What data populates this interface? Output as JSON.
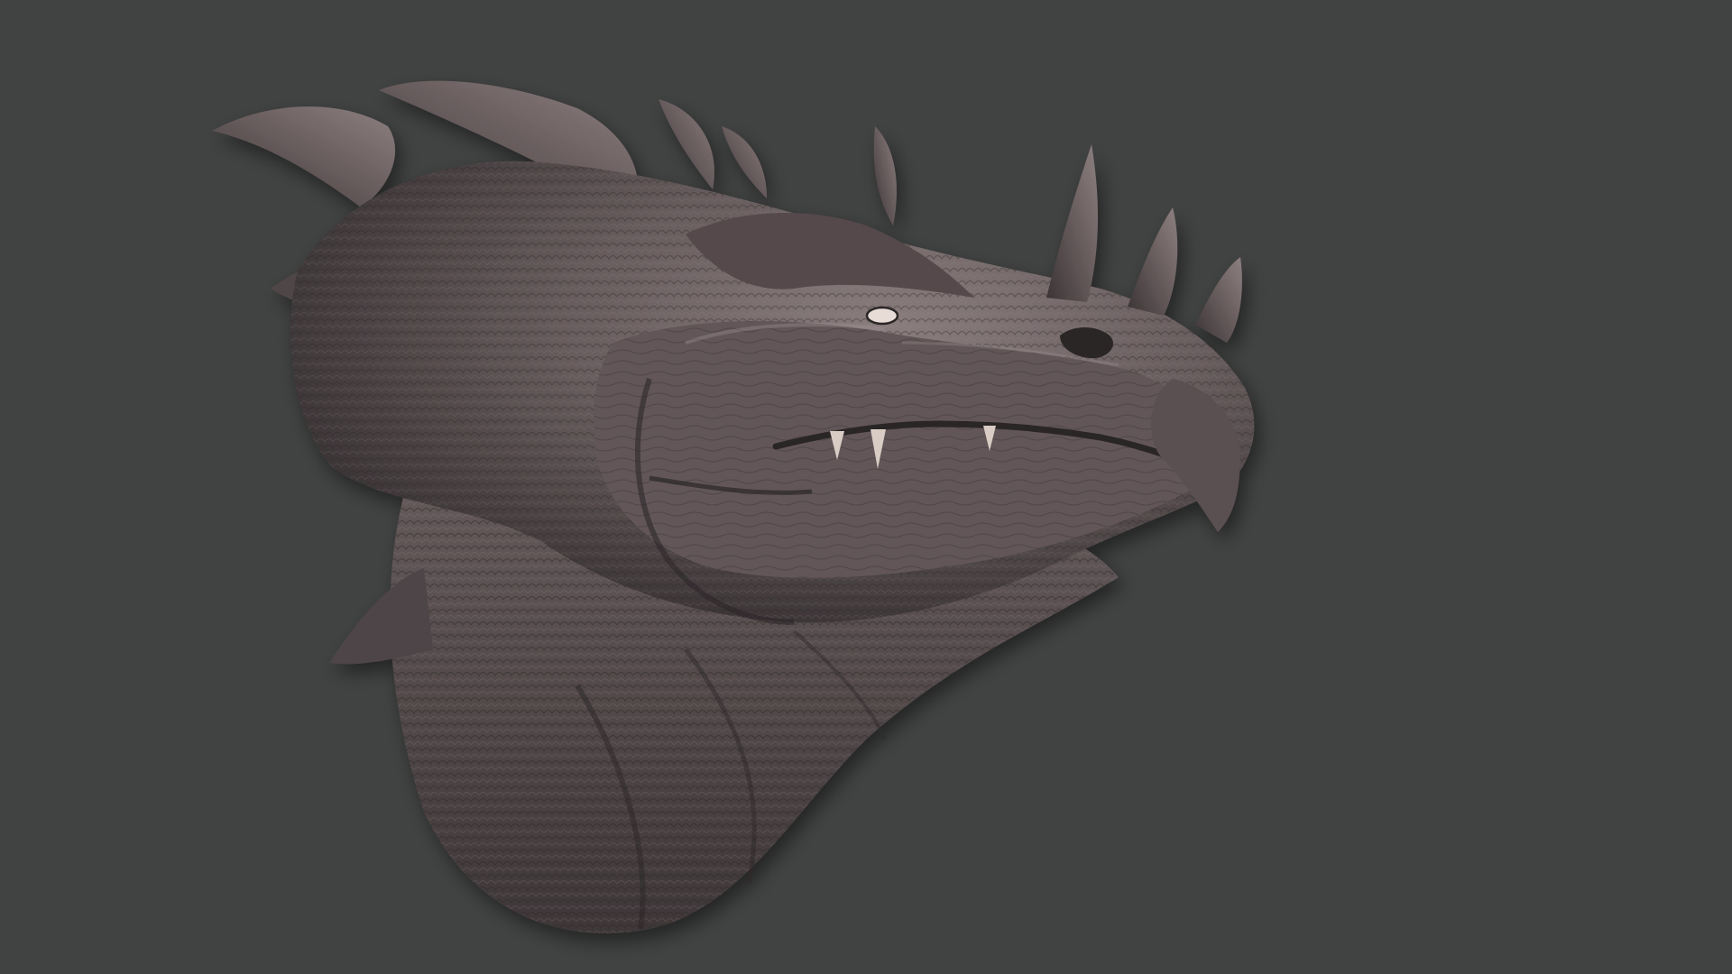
{
  "scene": {
    "title": "",
    "subject": "dragon-head-sculpt"
  },
  "colors": {
    "background": "#414242",
    "skin_base": "#5f5556",
    "skin_light": "#8a7d7e",
    "skin_dark": "#2f2a2b",
    "horn": "#6b6061",
    "teeth": "#d9ccc4",
    "eye": "#e7dcd6"
  }
}
